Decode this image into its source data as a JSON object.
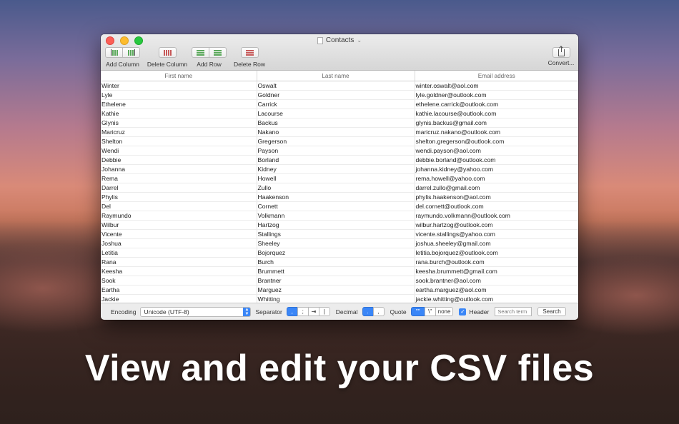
{
  "window": {
    "title": "Contacts"
  },
  "toolbar": {
    "add_column": "Add Column",
    "delete_column": "Delete Column",
    "add_row": "Add Row",
    "delete_row": "Delete Row",
    "convert": "Convert..."
  },
  "table": {
    "headers": [
      "First name",
      "Last name",
      "Email address"
    ],
    "rows": [
      [
        "Winter",
        "Oswalt",
        "winter.oswalt@aol.com"
      ],
      [
        "Lyle",
        "Goldner",
        "lyle.goldner@outlook.com"
      ],
      [
        "Ethelene",
        "Carrick",
        "ethelene.carrick@outlook.com"
      ],
      [
        "Kathie",
        "Lacourse",
        "kathie.lacourse@outlook.com"
      ],
      [
        "Glynis",
        "Backus",
        "glynis.backus@gmail.com"
      ],
      [
        "Maricruz",
        "Nakano",
        "maricruz.nakano@outlook.com"
      ],
      [
        "Shelton",
        "Gregerson",
        "shelton.gregerson@outlook.com"
      ],
      [
        "Wendi",
        "Payson",
        "wendi.payson@aol.com"
      ],
      [
        "Debbie",
        "Borland",
        "debbie.borland@outlook.com"
      ],
      [
        "Johanna",
        "Kidney",
        "johanna.kidney@yahoo.com"
      ],
      [
        "Rema",
        "Howell",
        "rema.howell@yahoo.com"
      ],
      [
        "Darrel",
        "Zullo",
        "darrel.zullo@gmail.com"
      ],
      [
        "Phylis",
        "Haakenson",
        "phylis.haakenson@aol.com"
      ],
      [
        "Del",
        "Cornett",
        "del.cornett@outlook.com"
      ],
      [
        "Raymundo",
        "Volkmann",
        "raymundo.volkmann@outlook.com"
      ],
      [
        "Wilbur",
        "Hartzog",
        "wilbur.hartzog@outlook.com"
      ],
      [
        "Vicente",
        "Stallings",
        "vicente.stallings@yahoo.com"
      ],
      [
        "Joshua",
        "Sheeley",
        "joshua.sheeley@gmail.com"
      ],
      [
        "Letitia",
        "Bojorquez",
        "letitia.bojorquez@outlook.com"
      ],
      [
        "Rana",
        "Burch",
        "rana.burch@outlook.com"
      ],
      [
        "Keesha",
        "Brummett",
        "keesha.brummett@gmail.com"
      ],
      [
        "Sook",
        "Brantner",
        "sook.brantner@aol.com"
      ],
      [
        "Eartha",
        "Marguez",
        "eartha.marguez@aol.com"
      ],
      [
        "Jackie",
        "Whitting",
        "jackie.whitting@outlook.com"
      ]
    ]
  },
  "statusbar": {
    "encoding_label": "Encoding",
    "encoding_value": "Unicode (UTF-8)",
    "separator_label": "Separator",
    "separator_options": [
      ",",
      ";",
      "⇥",
      "|"
    ],
    "decimal_label": "Decimal",
    "decimal_options": [
      ".",
      ","
    ],
    "quote_label": "Quote",
    "quote_options": [
      "\"\"",
      "\\\"",
      "none"
    ],
    "header_label": "Header",
    "search_placeholder": "Search term",
    "search_button": "Search"
  },
  "caption": "View and edit your CSV files"
}
